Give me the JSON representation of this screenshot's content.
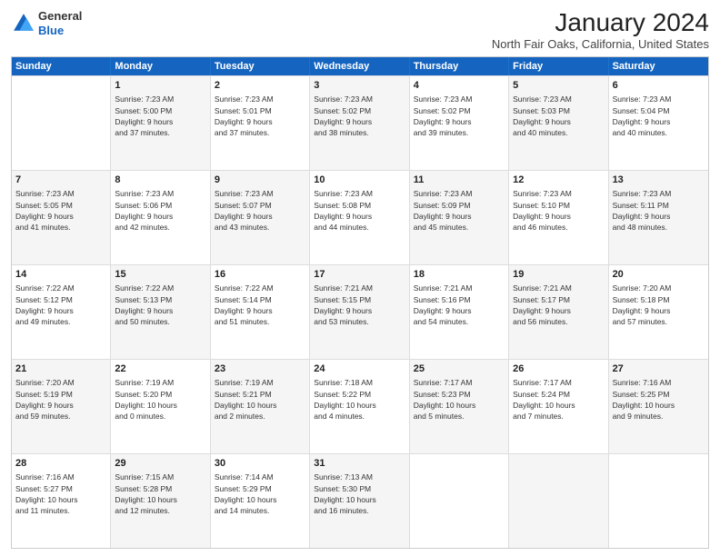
{
  "logo": {
    "line1": "General",
    "line2": "Blue"
  },
  "title": "January 2024",
  "location": "North Fair Oaks, California, United States",
  "header_days": [
    "Sunday",
    "Monday",
    "Tuesday",
    "Wednesday",
    "Thursday",
    "Friday",
    "Saturday"
  ],
  "rows": [
    [
      {
        "day": "",
        "lines": [],
        "alt": false
      },
      {
        "day": "1",
        "lines": [
          "Sunrise: 7:23 AM",
          "Sunset: 5:00 PM",
          "Daylight: 9 hours",
          "and 37 minutes."
        ],
        "alt": true
      },
      {
        "day": "2",
        "lines": [
          "Sunrise: 7:23 AM",
          "Sunset: 5:01 PM",
          "Daylight: 9 hours",
          "and 37 minutes."
        ],
        "alt": false
      },
      {
        "day": "3",
        "lines": [
          "Sunrise: 7:23 AM",
          "Sunset: 5:02 PM",
          "Daylight: 9 hours",
          "and 38 minutes."
        ],
        "alt": true
      },
      {
        "day": "4",
        "lines": [
          "Sunrise: 7:23 AM",
          "Sunset: 5:02 PM",
          "Daylight: 9 hours",
          "and 39 minutes."
        ],
        "alt": false
      },
      {
        "day": "5",
        "lines": [
          "Sunrise: 7:23 AM",
          "Sunset: 5:03 PM",
          "Daylight: 9 hours",
          "and 40 minutes."
        ],
        "alt": true
      },
      {
        "day": "6",
        "lines": [
          "Sunrise: 7:23 AM",
          "Sunset: 5:04 PM",
          "Daylight: 9 hours",
          "and 40 minutes."
        ],
        "alt": false
      }
    ],
    [
      {
        "day": "7",
        "lines": [
          "Sunrise: 7:23 AM",
          "Sunset: 5:05 PM",
          "Daylight: 9 hours",
          "and 41 minutes."
        ],
        "alt": true
      },
      {
        "day": "8",
        "lines": [
          "Sunrise: 7:23 AM",
          "Sunset: 5:06 PM",
          "Daylight: 9 hours",
          "and 42 minutes."
        ],
        "alt": false
      },
      {
        "day": "9",
        "lines": [
          "Sunrise: 7:23 AM",
          "Sunset: 5:07 PM",
          "Daylight: 9 hours",
          "and 43 minutes."
        ],
        "alt": true
      },
      {
        "day": "10",
        "lines": [
          "Sunrise: 7:23 AM",
          "Sunset: 5:08 PM",
          "Daylight: 9 hours",
          "and 44 minutes."
        ],
        "alt": false
      },
      {
        "day": "11",
        "lines": [
          "Sunrise: 7:23 AM",
          "Sunset: 5:09 PM",
          "Daylight: 9 hours",
          "and 45 minutes."
        ],
        "alt": true
      },
      {
        "day": "12",
        "lines": [
          "Sunrise: 7:23 AM",
          "Sunset: 5:10 PM",
          "Daylight: 9 hours",
          "and 46 minutes."
        ],
        "alt": false
      },
      {
        "day": "13",
        "lines": [
          "Sunrise: 7:23 AM",
          "Sunset: 5:11 PM",
          "Daylight: 9 hours",
          "and 48 minutes."
        ],
        "alt": true
      }
    ],
    [
      {
        "day": "14",
        "lines": [
          "Sunrise: 7:22 AM",
          "Sunset: 5:12 PM",
          "Daylight: 9 hours",
          "and 49 minutes."
        ],
        "alt": false
      },
      {
        "day": "15",
        "lines": [
          "Sunrise: 7:22 AM",
          "Sunset: 5:13 PM",
          "Daylight: 9 hours",
          "and 50 minutes."
        ],
        "alt": true
      },
      {
        "day": "16",
        "lines": [
          "Sunrise: 7:22 AM",
          "Sunset: 5:14 PM",
          "Daylight: 9 hours",
          "and 51 minutes."
        ],
        "alt": false
      },
      {
        "day": "17",
        "lines": [
          "Sunrise: 7:21 AM",
          "Sunset: 5:15 PM",
          "Daylight: 9 hours",
          "and 53 minutes."
        ],
        "alt": true
      },
      {
        "day": "18",
        "lines": [
          "Sunrise: 7:21 AM",
          "Sunset: 5:16 PM",
          "Daylight: 9 hours",
          "and 54 minutes."
        ],
        "alt": false
      },
      {
        "day": "19",
        "lines": [
          "Sunrise: 7:21 AM",
          "Sunset: 5:17 PM",
          "Daylight: 9 hours",
          "and 56 minutes."
        ],
        "alt": true
      },
      {
        "day": "20",
        "lines": [
          "Sunrise: 7:20 AM",
          "Sunset: 5:18 PM",
          "Daylight: 9 hours",
          "and 57 minutes."
        ],
        "alt": false
      }
    ],
    [
      {
        "day": "21",
        "lines": [
          "Sunrise: 7:20 AM",
          "Sunset: 5:19 PM",
          "Daylight: 9 hours",
          "and 59 minutes."
        ],
        "alt": true
      },
      {
        "day": "22",
        "lines": [
          "Sunrise: 7:19 AM",
          "Sunset: 5:20 PM",
          "Daylight: 10 hours",
          "and 0 minutes."
        ],
        "alt": false
      },
      {
        "day": "23",
        "lines": [
          "Sunrise: 7:19 AM",
          "Sunset: 5:21 PM",
          "Daylight: 10 hours",
          "and 2 minutes."
        ],
        "alt": true
      },
      {
        "day": "24",
        "lines": [
          "Sunrise: 7:18 AM",
          "Sunset: 5:22 PM",
          "Daylight: 10 hours",
          "and 4 minutes."
        ],
        "alt": false
      },
      {
        "day": "25",
        "lines": [
          "Sunrise: 7:17 AM",
          "Sunset: 5:23 PM",
          "Daylight: 10 hours",
          "and 5 minutes."
        ],
        "alt": true
      },
      {
        "day": "26",
        "lines": [
          "Sunrise: 7:17 AM",
          "Sunset: 5:24 PM",
          "Daylight: 10 hours",
          "and 7 minutes."
        ],
        "alt": false
      },
      {
        "day": "27",
        "lines": [
          "Sunrise: 7:16 AM",
          "Sunset: 5:25 PM",
          "Daylight: 10 hours",
          "and 9 minutes."
        ],
        "alt": true
      }
    ],
    [
      {
        "day": "28",
        "lines": [
          "Sunrise: 7:16 AM",
          "Sunset: 5:27 PM",
          "Daylight: 10 hours",
          "and 11 minutes."
        ],
        "alt": false
      },
      {
        "day": "29",
        "lines": [
          "Sunrise: 7:15 AM",
          "Sunset: 5:28 PM",
          "Daylight: 10 hours",
          "and 12 minutes."
        ],
        "alt": true
      },
      {
        "day": "30",
        "lines": [
          "Sunrise: 7:14 AM",
          "Sunset: 5:29 PM",
          "Daylight: 10 hours",
          "and 14 minutes."
        ],
        "alt": false
      },
      {
        "day": "31",
        "lines": [
          "Sunrise: 7:13 AM",
          "Sunset: 5:30 PM",
          "Daylight: 10 hours",
          "and 16 minutes."
        ],
        "alt": true
      },
      {
        "day": "",
        "lines": [],
        "alt": false
      },
      {
        "day": "",
        "lines": [],
        "alt": true
      },
      {
        "day": "",
        "lines": [],
        "alt": false
      }
    ]
  ]
}
